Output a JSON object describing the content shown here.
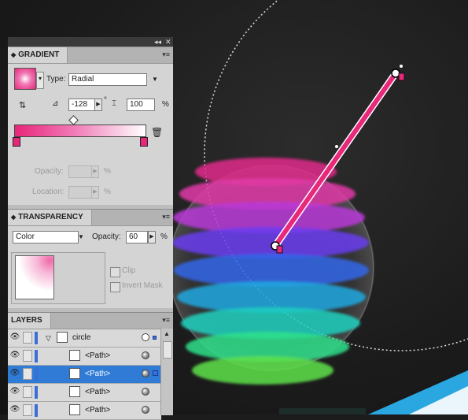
{
  "window_controls": {
    "collapse_icon": "double-chevron-icon",
    "close_icon": "close-icon",
    "collapse_glyph": "◂◂",
    "close_glyph": "✕"
  },
  "gradient_panel": {
    "title": "GRADIENT",
    "type_label": "Type:",
    "type_value": "Radial",
    "angle_value": "-128",
    "angle_unit": "°",
    "aspect_value": "100",
    "aspect_unit": "%",
    "opacity_label": "Opacity:",
    "opacity_unit": "%",
    "location_label": "Location:",
    "location_unit": "%",
    "gradient_start_color": "#e8267a",
    "gradient_end_color": "#ffffff"
  },
  "transparency_panel": {
    "title": "TRANSPARENCY",
    "blend_mode": "Color",
    "opacity_label": "Opacity:",
    "opacity_value": "60",
    "opacity_unit": "%",
    "clip_label": "Clip",
    "invert_mask_label": "Invert Mask"
  },
  "layers_panel": {
    "title": "LAYERS",
    "rows": [
      {
        "name": "circle",
        "selected": false,
        "group": true
      },
      {
        "name": "<Path>",
        "selected": false
      },
      {
        "name": "<Path>",
        "selected": true
      },
      {
        "name": "<Path>",
        "selected": false
      },
      {
        "name": "<Path>",
        "selected": false
      }
    ]
  },
  "colors": {
    "panel_bg": "#d4d4d4",
    "canvas_bg": "#1c1c1c",
    "gradient_tool": "#e8287a",
    "selection": "#2f7bd6",
    "accent_cyan": "#2aa7e0"
  }
}
